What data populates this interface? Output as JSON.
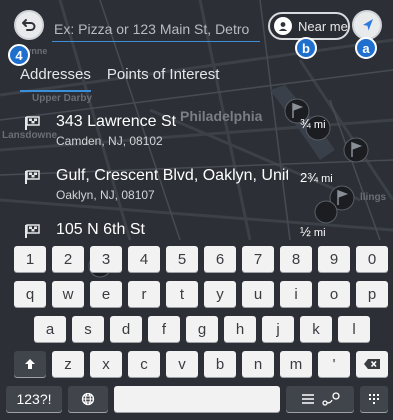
{
  "search": {
    "placeholder": "Ex: Pizza or 123 Main St, Detro",
    "near_me_label": "Near me"
  },
  "markers": {
    "back": "4",
    "near_me": "b",
    "navigate": "a"
  },
  "tabs": [
    {
      "label": "Addresses",
      "active": true
    },
    {
      "label": "Points of Interest",
      "active": false
    }
  ],
  "results": [
    {
      "title": "343 Lawrence St",
      "subtitle": "Camden, NJ, 08102",
      "distance": "¾",
      "unit": "mi"
    },
    {
      "title": "Gulf, Crescent Blvd, Oaklyn, United",
      "subtitle": "Oaklyn, NJ, 08107",
      "distance": "2¾",
      "unit": "mi"
    },
    {
      "title": "105 N 6th St",
      "subtitle": "",
      "distance": "½",
      "unit": "mi"
    }
  ],
  "map_labels": {
    "wynne": "Wynne",
    "upper_darby": "Upper Darby",
    "lansdowne": "Lansdowne",
    "philadelphia": "Philadelphia",
    "collings": "llings"
  },
  "keyboard": {
    "row1": [
      "1",
      "2",
      "3",
      "4",
      "5",
      "6",
      "7",
      "8",
      "9",
      "0"
    ],
    "row2": [
      "q",
      "w",
      "e",
      "r",
      "t",
      "y",
      "u",
      "i",
      "o",
      "p"
    ],
    "row3": [
      "a",
      "s",
      "d",
      "f",
      "g",
      "h",
      "j",
      "k",
      "l"
    ],
    "row4": [
      "z",
      "x",
      "c",
      "v",
      "b",
      "n",
      "m",
      "'"
    ],
    "symbols_label": "123?!",
    "shift_icon": "shift-arrow-icon",
    "backspace_icon": "backspace-icon",
    "globe_icon": "globe-icon",
    "list_icon": "list-icon",
    "route_icon": "route-icon",
    "grid_icon": "grid-icon"
  },
  "colors": {
    "accent": "#1f6fcf",
    "underline": "#3a8fd8",
    "map_dark": "#2a2d33",
    "key_light": "#f2f2f3",
    "key_dark": "#40444b"
  }
}
